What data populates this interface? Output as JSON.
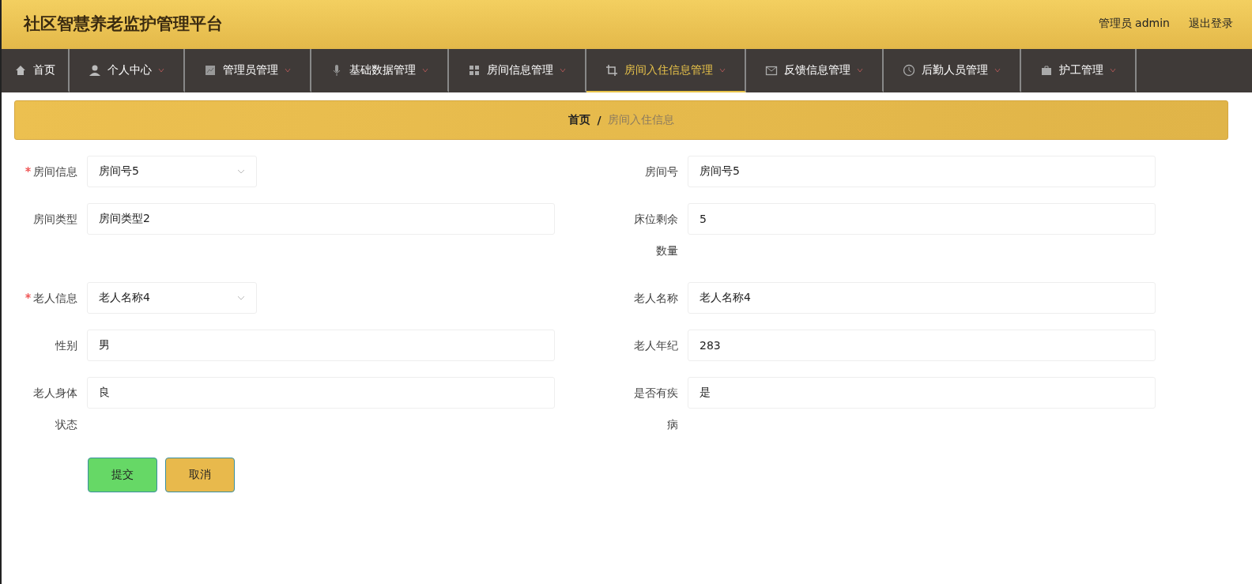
{
  "header": {
    "title": "社区智慧养老监护管理平台",
    "user": "管理员 admin",
    "logout": "退出登录"
  },
  "nav": [
    {
      "label": "首页",
      "selected": false,
      "has_menu": false
    },
    {
      "label": "个人中心",
      "selected": false,
      "has_menu": true
    },
    {
      "label": "管理员管理",
      "selected": false,
      "has_menu": true
    },
    {
      "label": "基础数据管理",
      "selected": false,
      "has_menu": true
    },
    {
      "label": "房间信息管理",
      "selected": false,
      "has_menu": true
    },
    {
      "label": "房间入住信息管理",
      "selected": true,
      "has_menu": true
    },
    {
      "label": "反馈信息管理",
      "selected": false,
      "has_menu": true
    },
    {
      "label": "后勤人员管理",
      "selected": false,
      "has_menu": true
    },
    {
      "label": "护工管理",
      "selected": false,
      "has_menu": true
    }
  ],
  "breadcrumb": [
    "首页",
    "房间入住信息"
  ],
  "breadcrumb_separator": "/",
  "form": [
    {
      "left": {
        "label": "房间信息",
        "kind": "select",
        "required": true,
        "value": "房间号5"
      },
      "right": {
        "label": "房间号",
        "kind": "input",
        "required": false,
        "value": "房间号5"
      }
    },
    {
      "left": {
        "label": "房间类型",
        "kind": "input",
        "required": false,
        "value": "房间类型2"
      },
      "right": {
        "label": "床位剩余数量",
        "kind": "input",
        "required": false,
        "value": "5"
      }
    },
    {
      "left": {
        "label": "老人信息",
        "kind": "select",
        "required": true,
        "value": "老人名称4"
      },
      "right": {
        "label": "老人名称",
        "kind": "input",
        "required": false,
        "value": "老人名称4"
      }
    },
    {
      "left": {
        "label": "性别",
        "kind": "input",
        "required": false,
        "value": "男"
      },
      "right": {
        "label": "老人年纪",
        "kind": "input",
        "required": false,
        "value": "283"
      }
    },
    {
      "left": {
        "label": "老人身体状态",
        "kind": "input",
        "required": false,
        "value": "良"
      },
      "right": {
        "label": "是否有疾病",
        "kind": "input",
        "required": false,
        "value": "是"
      }
    }
  ],
  "buttons": [
    {
      "label": "提交",
      "kind": "primary"
    },
    {
      "label": "取消",
      "kind": "secondary"
    }
  ]
}
